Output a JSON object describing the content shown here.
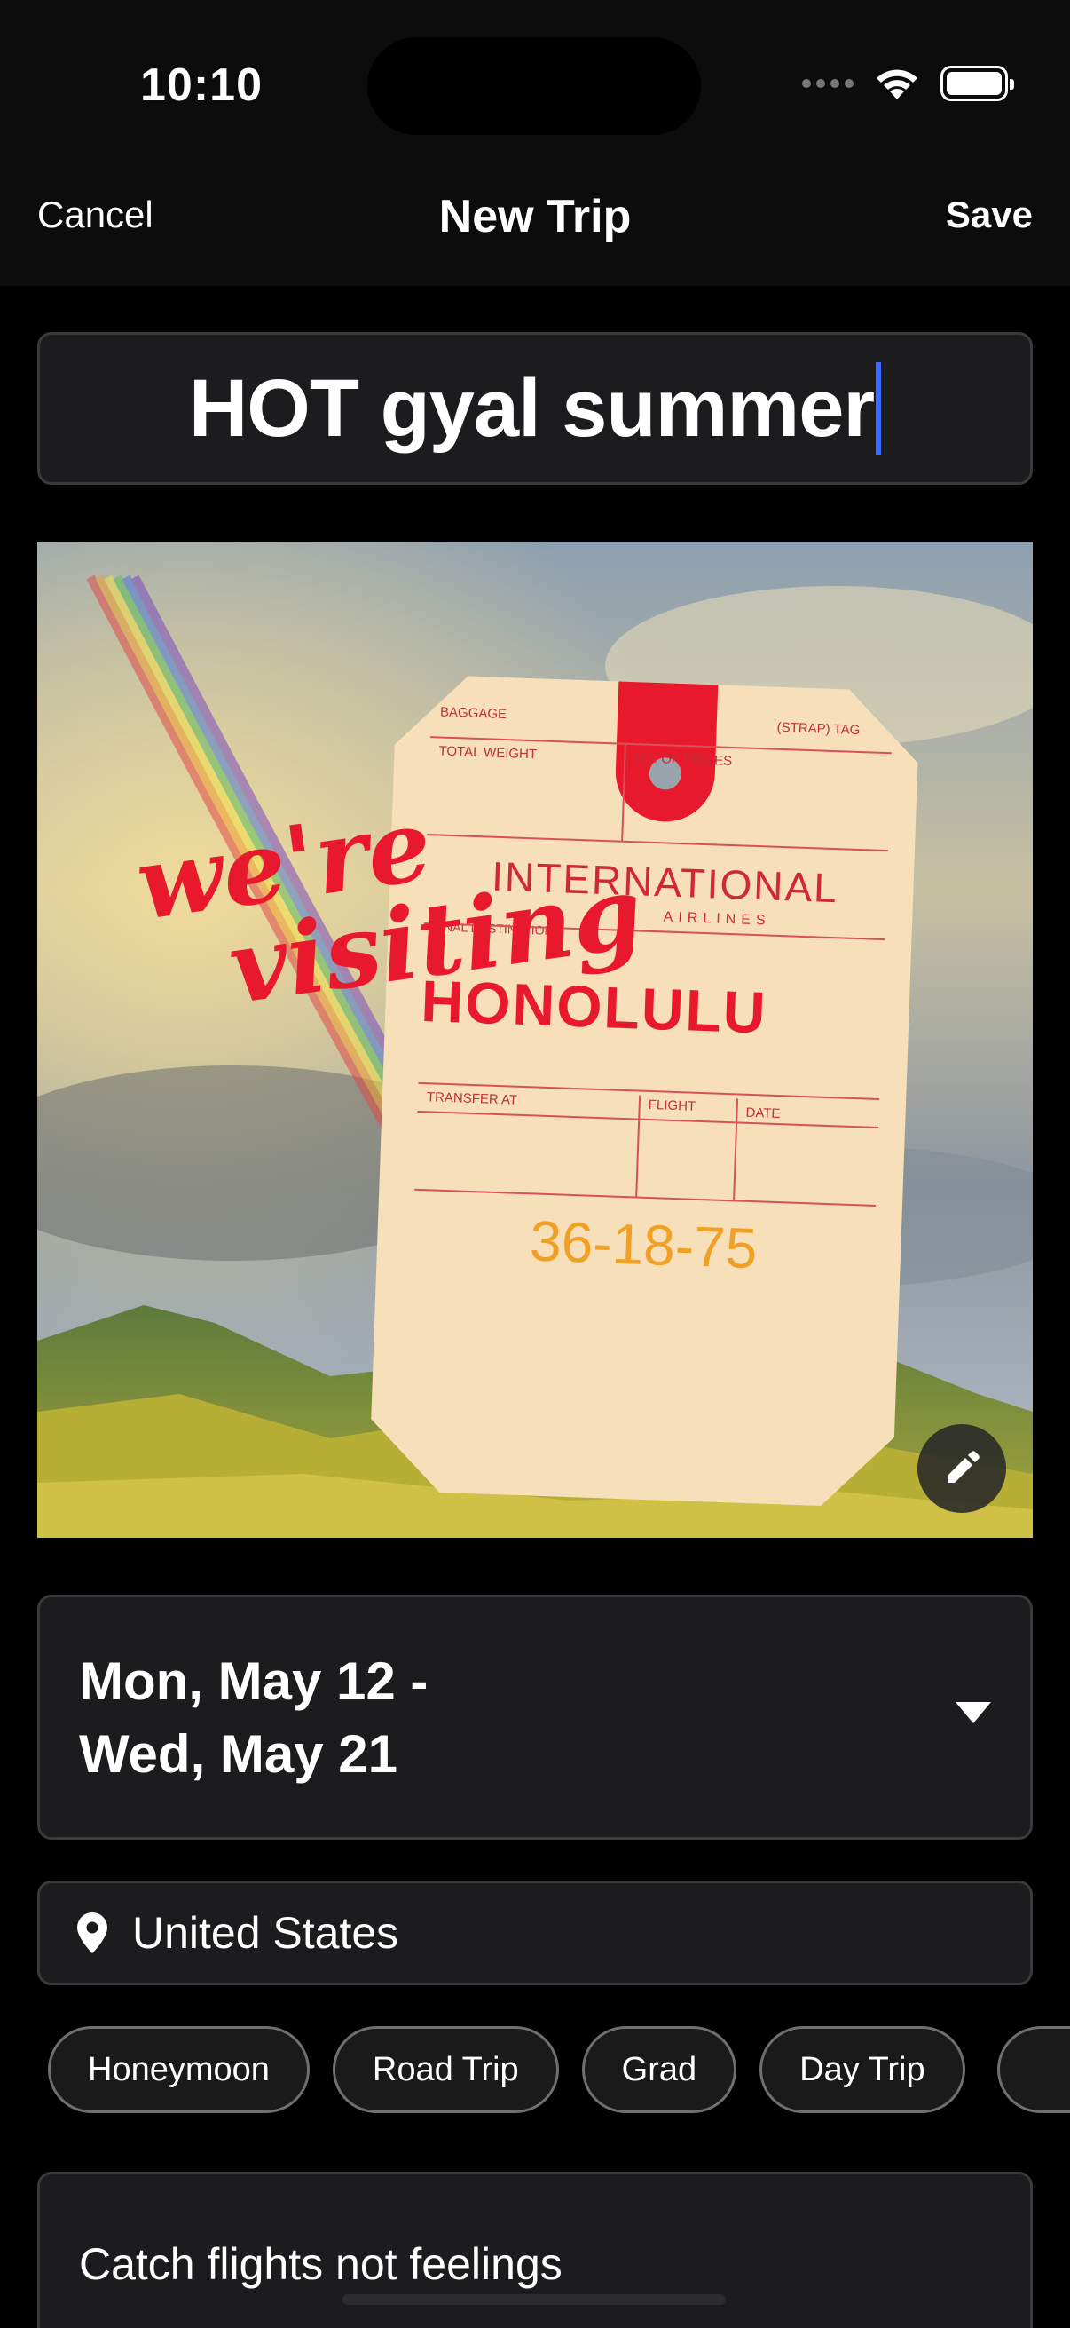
{
  "status_bar": {
    "time": "10:10"
  },
  "nav": {
    "cancel_label": "Cancel",
    "title": "New Trip",
    "save_label": "Save"
  },
  "trip": {
    "name": "HOT gyal summer"
  },
  "cover": {
    "script_line1": "we're",
    "script_line2": "visiting",
    "tag": {
      "baggage": "BAGGAGE",
      "strap_tag": "(STRAP) TAG",
      "total_weight": "TOTAL WEIGHT",
      "no_of_pieces": "NO. OF PIECES",
      "airline": "INTERNATIONAL",
      "airline_sub": "AIRLINES",
      "final_destination": "FINAL DESTINATION",
      "destination": "HONOLULU",
      "transfer_at": "TRANSFER AT",
      "flight": "FLIGHT",
      "date": "DATE",
      "code": "36-18-75"
    },
    "edit_icon": "pencil-icon"
  },
  "dates": {
    "line1": "Mon, May 12 -",
    "line2": "Wed, May 21",
    "icon": "chevron-down-icon"
  },
  "location": {
    "icon": "map-pin-icon",
    "value": "United States"
  },
  "chips": [
    "Honeymoon",
    "Road Trip",
    "Grad",
    "Day Trip"
  ],
  "notes": {
    "value": "Catch flights not feelings"
  },
  "colors": {
    "accent_caret": "#3d6bff",
    "tag_red": "#e8192c",
    "tag_paper": "#f7dfb9",
    "tag_code": "#f0a125"
  }
}
